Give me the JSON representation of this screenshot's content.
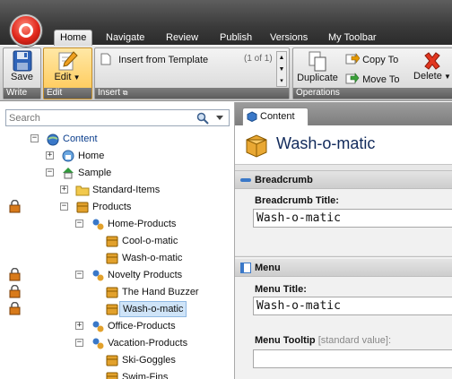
{
  "ribbon": {
    "tabs": [
      {
        "label": "Home",
        "active": true
      },
      {
        "label": "Navigate"
      },
      {
        "label": "Review"
      },
      {
        "label": "Publish"
      },
      {
        "label": "Versions"
      },
      {
        "label": "My Toolbar"
      }
    ],
    "groups": {
      "write": {
        "label": "Write",
        "save": "Save"
      },
      "edit": {
        "label": "Edit",
        "edit": "Edit"
      },
      "insert": {
        "label": "Insert",
        "insert_from_template": "Insert from Template",
        "count": "(1 of 1)"
      },
      "operations": {
        "label": "Operations",
        "duplicate": "Duplicate",
        "copy_to": "Copy To",
        "move_to": "Move To",
        "delete": "Delete"
      }
    }
  },
  "search": {
    "placeholder": "Search"
  },
  "tree": {
    "content": "Content",
    "home": "Home",
    "sample": "Sample",
    "standard_items": "Standard-Items",
    "products": "Products",
    "home_products": "Home-Products",
    "cool_o_matic": "Cool-o-matic",
    "wash_o_matic_1": "Wash-o-matic",
    "novelty_products": "Novelty Products",
    "the_hand_buzzer": "The Hand Buzzer",
    "wash_o_matic_2": "Wash-o-matic",
    "office_products": "Office-Products",
    "vacation_products": "Vacation-Products",
    "ski_goggles": "Ski-Goggles",
    "swim_fins": "Swim-Fins"
  },
  "editor": {
    "tab": "Content",
    "item_title": "Wash-o-matic",
    "breadcrumb_section": "Breadcrumb",
    "breadcrumb_title_label": "Breadcrumb Title:",
    "breadcrumb_title_value": "Wash-o-matic",
    "menu_section": "Menu",
    "menu_title_label": "Menu Title:",
    "menu_title_value": "Wash-o-matic",
    "menu_tooltip_label": "Menu Tooltip",
    "menu_tooltip_hint": "[standard value]:",
    "menu_tooltip_value": ""
  },
  "colors": {
    "accent": "#ffc64f",
    "title": "#112a5b",
    "selection": "#cfe4f8"
  }
}
